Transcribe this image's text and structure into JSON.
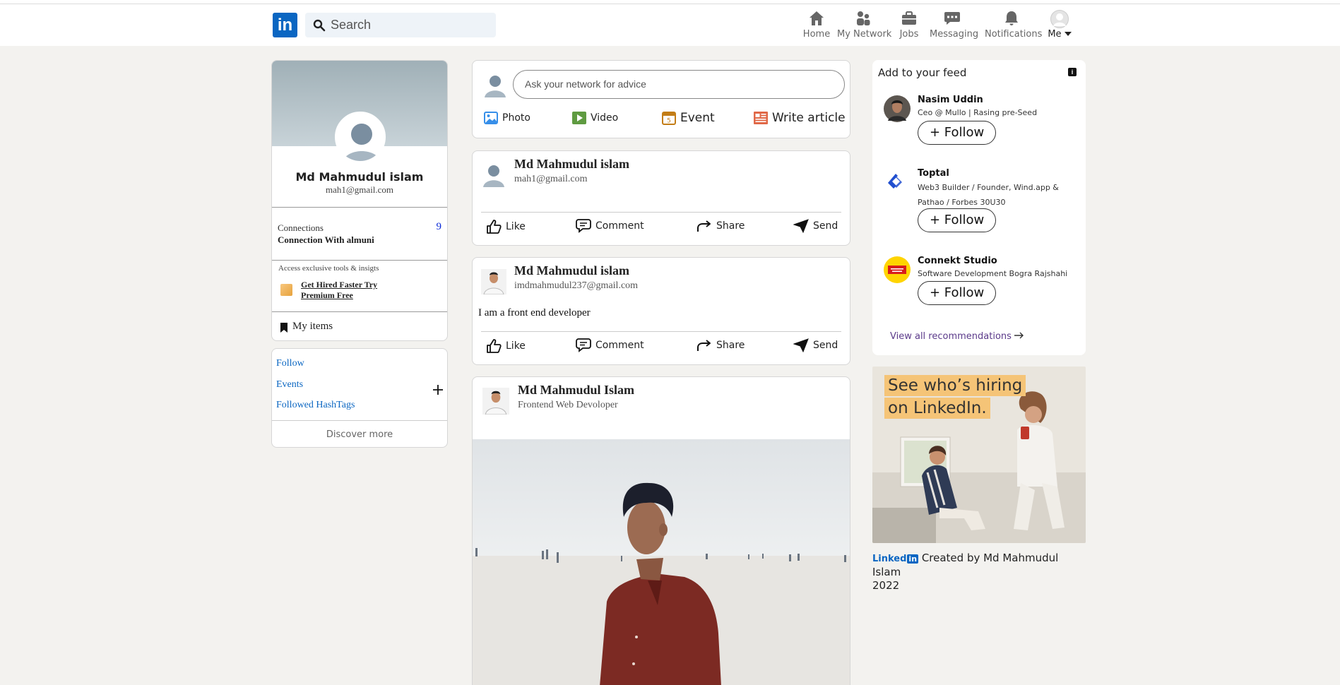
{
  "header": {
    "logo_text": "in",
    "search_placeholder": "Search",
    "nav": [
      {
        "label": "Home",
        "icon": "home-icon"
      },
      {
        "label": "My Network",
        "icon": "network-icon"
      },
      {
        "label": "Jobs",
        "icon": "briefcase-icon"
      },
      {
        "label": "Messaging",
        "icon": "messaging-icon"
      },
      {
        "label": "Notifications",
        "icon": "bell-icon"
      },
      {
        "label": "Me",
        "icon": "avatar-icon"
      }
    ]
  },
  "profile": {
    "name": "Md Mahmudul islam",
    "email": "mah1@gmail.com",
    "connections_label": "Connections",
    "connections_count": "9",
    "connections_sub": "Connection With almuni",
    "premium_text": "Access exclusive tools & insigts",
    "premium_link": "Get Hired Faster Try Premium Free",
    "my_items": "My items"
  },
  "links": {
    "follow": "Follow",
    "events": "Events",
    "hashtags": "Followed HashTags",
    "discover": "Discover more"
  },
  "composer": {
    "placeholder": "Ask your network for advice",
    "actions": [
      "Photo",
      "Video",
      "Event",
      "Write article"
    ]
  },
  "posts": [
    {
      "name": "Md Mahmudul islam",
      "sub": "mah1@gmail.com",
      "text": ""
    },
    {
      "name": "Md Mahmudul islam",
      "sub": "imdmahmudul237@gmail.com",
      "text": "I am a front end developer"
    },
    {
      "name": "Md Mahmudul Islam",
      "sub": "Frontend Web Devoloper",
      "text": ""
    }
  ],
  "post_actions": [
    "Like",
    "Comment",
    "Share",
    "Send"
  ],
  "feed": {
    "title": "Add to your feed",
    "items": [
      {
        "name": "Nasim Uddin",
        "desc": "Ceo @ Mullo | Rasing pre-Seed",
        "button": "+ Follow"
      },
      {
        "name": "Toptal",
        "desc": "Web3 Builder / Founder, Wind.app & Pathao / Forbes 30U30",
        "button": "+ Follow"
      },
      {
        "name": "Connekt Studio",
        "desc": "Software Development Bogra Rajshahi",
        "button": "+ Follow"
      }
    ],
    "view_all": "View all recommendations"
  },
  "ad": {
    "line1": "See who’s hiring",
    "line2": "on LinkedIn."
  },
  "footer": {
    "brand": "Linked",
    "brand_in": "in",
    "created": "Created by Md Mahmudul Islam",
    "year": "2022"
  },
  "colors": {
    "brand": "#0a66c2",
    "link": "#0a66c2",
    "page_bg": "#f3f2ef"
  }
}
